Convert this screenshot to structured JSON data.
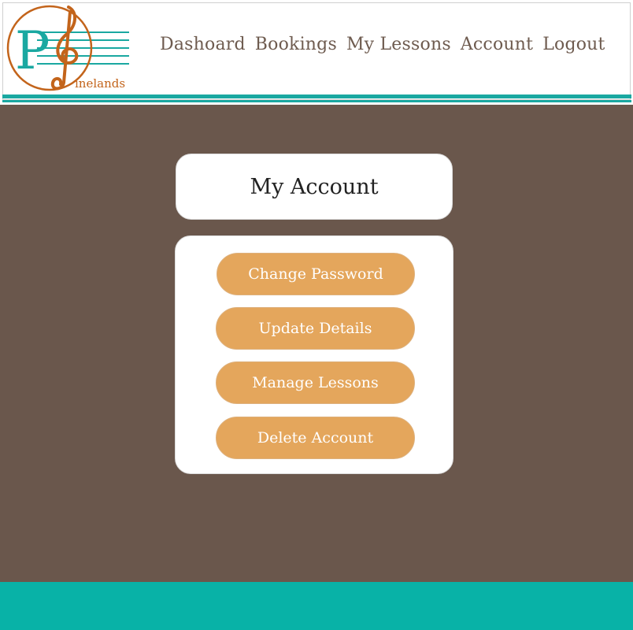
{
  "brand": {
    "logo_letter": "P",
    "logo_text": "inelands",
    "colors": {
      "teal": "#1aa8a1",
      "orange": "#c3641b",
      "brown": "#6a574c",
      "button": "#e4a65c"
    }
  },
  "nav": {
    "items": [
      {
        "label": "Dashoard"
      },
      {
        "label": "Bookings"
      },
      {
        "label": "My Lessons"
      },
      {
        "label": "Account"
      },
      {
        "label": "Logout"
      }
    ]
  },
  "account": {
    "title": "My Account",
    "buttons": [
      {
        "label": "Change Password"
      },
      {
        "label": "Update Details"
      },
      {
        "label": "Manage Lessons"
      },
      {
        "label": "Delete Account"
      }
    ]
  }
}
